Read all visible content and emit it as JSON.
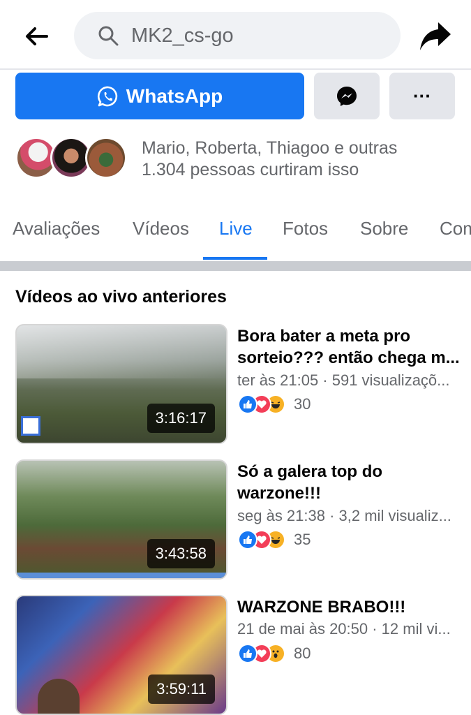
{
  "header": {
    "search_text": "MK2_cs-go"
  },
  "actions": {
    "whatsapp_label": "WhatsApp",
    "more_label": "···"
  },
  "likes": {
    "line1": "Mario, Roberta, Thiagoo e outras",
    "line2": "1.304 pessoas curtiram isso"
  },
  "tabs": [
    {
      "label": "Avaliações"
    },
    {
      "label": "Vídeos"
    },
    {
      "label": "Live",
      "active": true
    },
    {
      "label": "Fotos"
    },
    {
      "label": "Sobre"
    },
    {
      "label": "Com"
    }
  ],
  "section": {
    "title": "Vídeos ao vivo anteriores"
  },
  "videos": [
    {
      "title": "Bora bater a meta pro sorteio??? então chega m...",
      "meta": "ter às 21:05 · 591 visualizaçõ...",
      "duration": "3:16:17",
      "reactions": [
        "like",
        "love",
        "haha"
      ],
      "count": "30"
    },
    {
      "title": "Só a galera top do warzone!!!",
      "meta": "seg às 21:38 · 3,2 mil visualiz...",
      "duration": "3:43:58",
      "reactions": [
        "like",
        "love",
        "haha"
      ],
      "count": "35"
    },
    {
      "title": "WARZONE BRABO!!!",
      "meta": "21 de mai às 20:50 · 12 mil vi...",
      "duration": "3:59:11",
      "reactions": [
        "like",
        "love",
        "wow"
      ],
      "count": "80"
    }
  ],
  "colors": {
    "accent": "#1877f2",
    "secondary_text": "#65676b",
    "button_gray": "#e4e6eb"
  }
}
